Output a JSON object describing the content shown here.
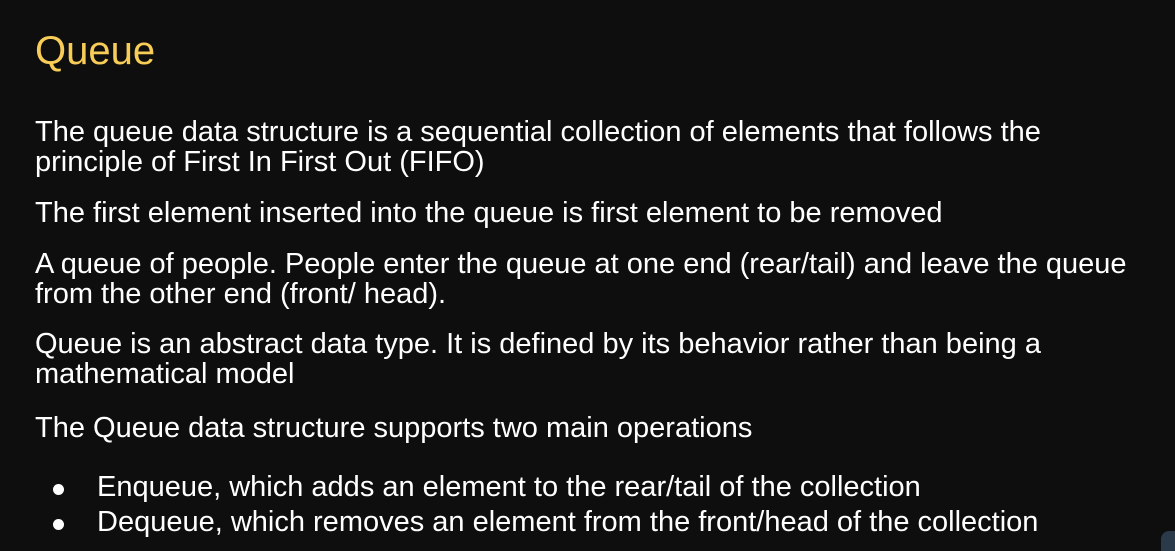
{
  "slide": {
    "title": "Queue",
    "paragraphs": [
      "The queue data structure is a sequential collection of elements that follows the principle of First In First Out (FIFO)",
      "The first element inserted into the queue is first element to be removed",
      "A queue of people. People enter the queue at one end (rear/tail) and leave the queue from the other end (front/ head).",
      "Queue is an abstract data type. It is defined by its behavior rather than being a mathematical model",
      "The Queue data structure supports two main operations"
    ],
    "bullets": [
      "Enqueue, which adds an element to the rear/tail of the collection",
      "Dequeue, which removes an element from the front/head of the collection"
    ]
  },
  "colors": {
    "background": "#0e0e0e",
    "title": "#f7cd57",
    "text": "#ffffff"
  }
}
